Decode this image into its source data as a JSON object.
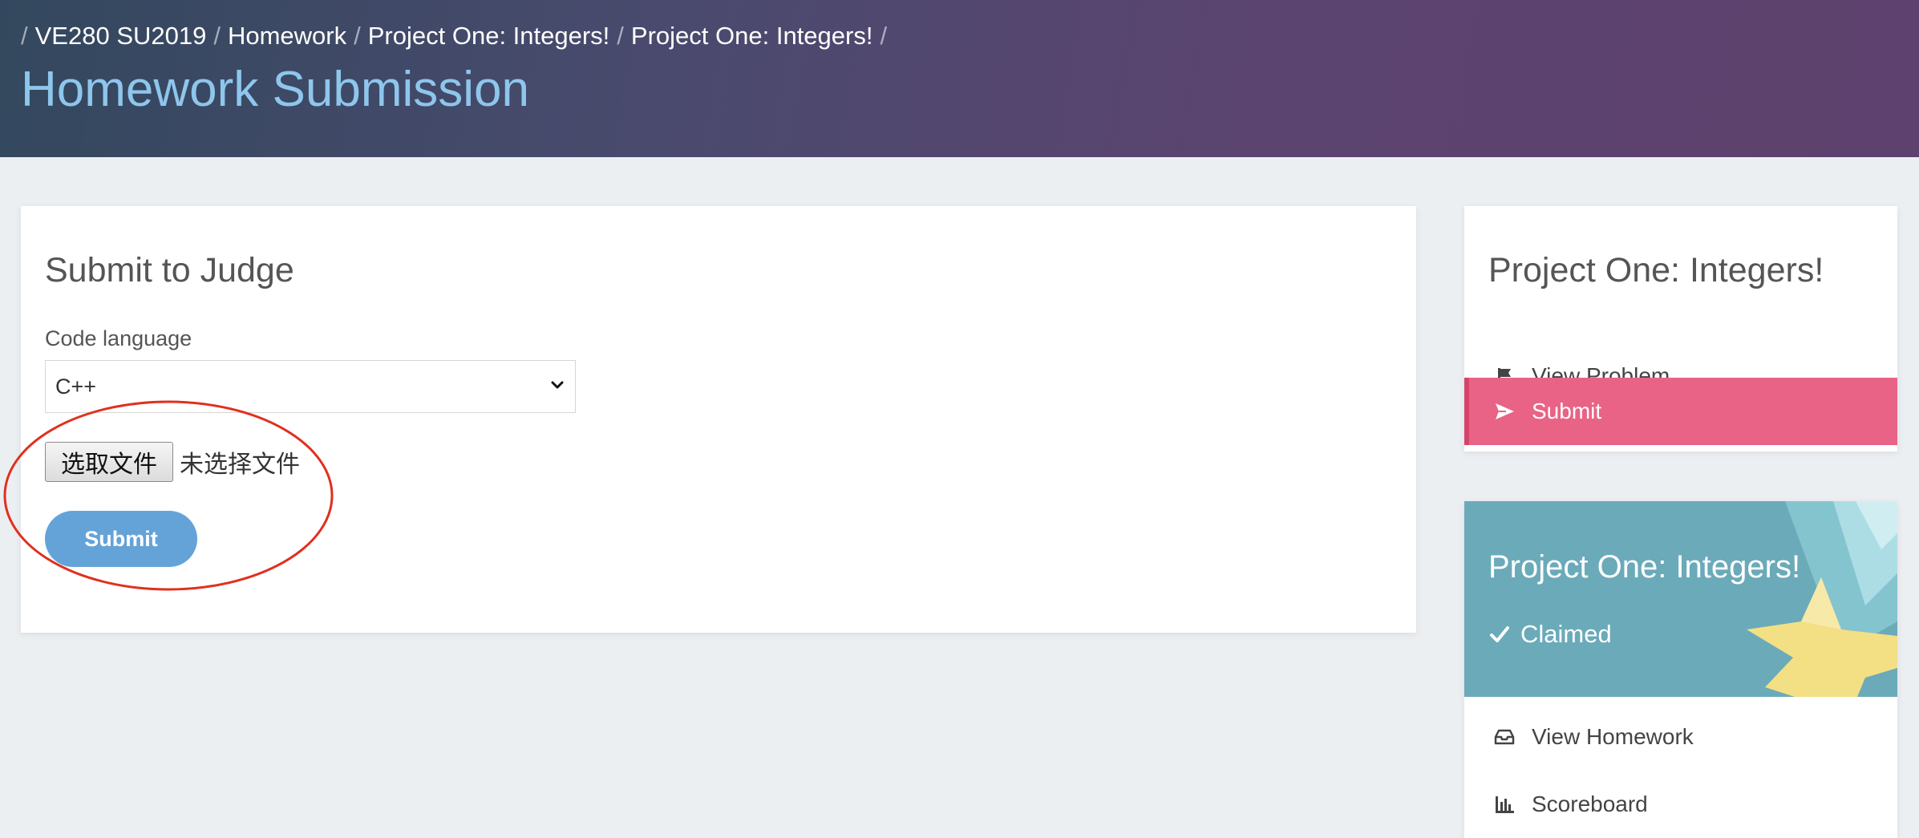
{
  "breadcrumb": {
    "items": [
      "VE280 SU2019",
      "Homework",
      "Project One: Integers!",
      "Project One: Integers!"
    ]
  },
  "page_title": "Homework Submission",
  "submit_form": {
    "title": "Submit to Judge",
    "language_label": "Code language",
    "language_value": "C++",
    "file_button_label": "选取文件",
    "file_status": "未选择文件",
    "submit_label": "Submit"
  },
  "sidebar": {
    "title": "Project One: Integers!",
    "items": [
      {
        "label": "View Problem",
        "icon": "flag-icon"
      },
      {
        "label": "Submit",
        "icon": "send-icon",
        "active": true
      }
    ]
  },
  "homework_card": {
    "title": "Project One: Integers!",
    "status": "Claimed",
    "items": [
      {
        "label": "View Homework",
        "icon": "inbox-icon"
      },
      {
        "label": "Scoreboard",
        "icon": "bar-chart-icon"
      }
    ]
  },
  "colors": {
    "header_gradient_start": "#33485e",
    "header_gradient_end": "#5e416e",
    "title_blue": "#8ec6ec",
    "submit_blue": "#64a3d8",
    "active_pink": "#e96386",
    "banner_teal": "#6baab9",
    "annotation_red": "#e0301e"
  }
}
